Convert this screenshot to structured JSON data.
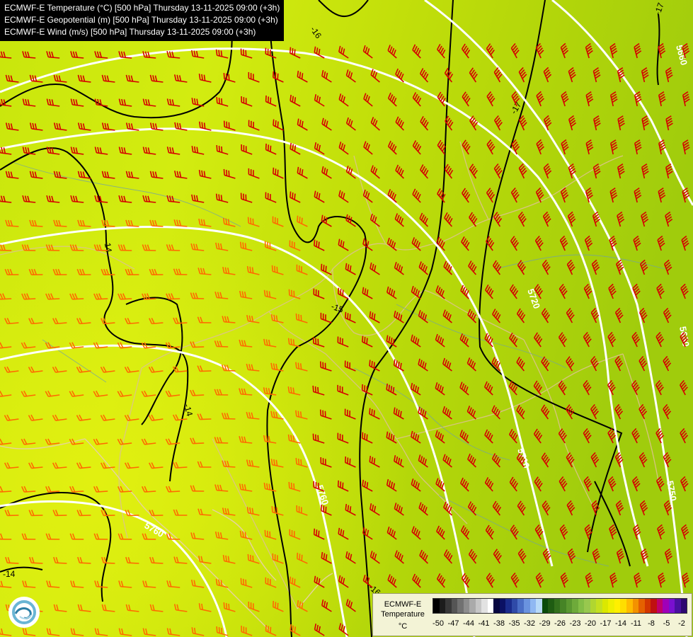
{
  "titles": [
    "ECMWF-E Temperature (°C) [500 hPa] Thursday 13-11-2025 09:00 (+3h)",
    "ECMWF-E Geopotential (m) [500 hPa] Thursday 13-11-2025 09:00 (+3h)",
    "ECMWF-E Wind (m/s) [500 hPa] Thursday 13-11-2025 09:00 (+3h)"
  ],
  "legend": {
    "model": "ECMWF-E",
    "variable": "Temperature",
    "unit": "°C",
    "tick_labels": [
      "-50",
      "-47",
      "-44",
      "-41",
      "-38",
      "-35",
      "-32",
      "-29",
      "-26",
      "-23",
      "-20",
      "-17",
      "-14",
      "-11",
      "-8",
      "-5",
      "-2"
    ],
    "colors": [
      "#000000",
      "#1c1c1c",
      "#383838",
      "#555555",
      "#717171",
      "#8d8d8d",
      "#aaaaaa",
      "#c6c6c6",
      "#e2e2e2",
      "#ffffff",
      "#060640",
      "#0b1063",
      "#1a2b8c",
      "#2f4aa8",
      "#4a6ec6",
      "#6a93df",
      "#90b8f2",
      "#b8daf8",
      "#0a4a0a",
      "#1f5c12",
      "#33701c",
      "#468426",
      "#5a9830",
      "#6eaa3a",
      "#83be46",
      "#98c84e",
      "#b0d630",
      "#c4e020",
      "#dbe800",
      "#eef000",
      "#fff000",
      "#ffdd00",
      "#ffbb00",
      "#f39200",
      "#e56100",
      "#d33700",
      "#c01010",
      "#c0006b",
      "#a000b8",
      "#7a10d0",
      "#4a10a0",
      "#2e0870"
    ]
  },
  "temperature_labels": [
    {
      "text": "-16"
    },
    {
      "text": "-17"
    },
    {
      "text": "-15"
    },
    {
      "text": "-14"
    },
    {
      "text": "-14"
    },
    {
      "text": "-14"
    },
    {
      "text": "-16"
    },
    {
      "text": "-17"
    }
  ],
  "geopotential_labels": [
    {
      "text": "5660"
    },
    {
      "text": "5720"
    },
    {
      "text": "5680"
    },
    {
      "text": "5710"
    },
    {
      "text": "5760"
    },
    {
      "text": "5750"
    },
    {
      "text": "5760"
    }
  ],
  "colors": {
    "field_warm": "#d3ec12",
    "field_mid": "#bddb0c",
    "field_cold": "#9ccc0a",
    "isotherm": "#000000",
    "isohypse": "#ffffff",
    "borders": "#d9c08a",
    "rivers": "#6fa0b0",
    "barb_warm": "#ff6a00",
    "barb_cold": "#d40000"
  }
}
